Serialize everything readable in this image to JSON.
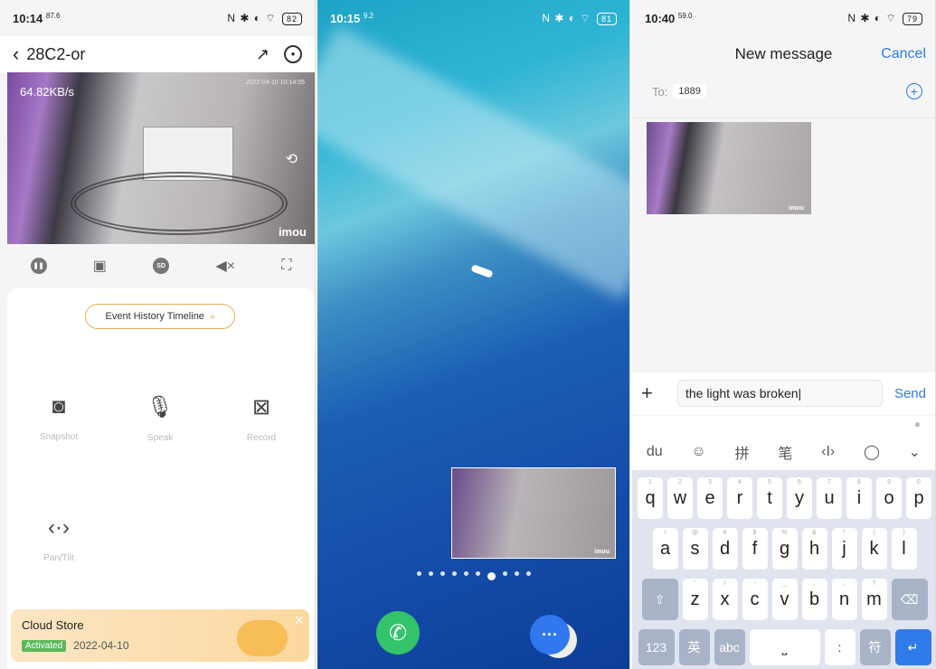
{
  "phone1": {
    "status": {
      "time": "10:14",
      "speed": "87.6",
      "battery": "82"
    },
    "header": {
      "title": "28C2-or"
    },
    "video": {
      "rate": "64.82KB/s",
      "timestamp": "2022-04-10 10:14:05",
      "brand": "imou"
    },
    "controls": {
      "sd": "SD"
    },
    "event_button": "Event History Timeline",
    "features": {
      "snapshot": "Snapshot",
      "speak": "Speak",
      "record": "Record",
      "pantilt": "Pan/Tilt"
    },
    "cloud": {
      "title": "Cloud Store",
      "status": "Activated",
      "date": "2022-04-10"
    }
  },
  "phone2": {
    "status": {
      "time": "10:15",
      "speed": "9.2",
      "battery": "81"
    },
    "pip": {
      "brand": "imou"
    },
    "page_dots": 10,
    "active_dot": 6
  },
  "phone3": {
    "status": {
      "time": "10:40",
      "speed": "59.0",
      "battery": "79"
    },
    "header": {
      "title": "New message",
      "cancel": "Cancel"
    },
    "to": {
      "label": "To:",
      "number": "1889"
    },
    "thumb": {
      "brand": "imou"
    },
    "compose": {
      "text": "the light was broken",
      "send": "Send"
    },
    "tools": [
      "du",
      "☺",
      "拼",
      "笔",
      "‹I›",
      "◯",
      "⌄"
    ],
    "keyboard": {
      "row1": [
        [
          "q",
          "1"
        ],
        [
          "w",
          "2"
        ],
        [
          "e",
          "3"
        ],
        [
          "r",
          "4"
        ],
        [
          "t",
          "5"
        ],
        [
          "y",
          "6"
        ],
        [
          "u",
          "7"
        ],
        [
          "i",
          "8"
        ],
        [
          "o",
          "9"
        ],
        [
          "p",
          "0"
        ]
      ],
      "row2": [
        [
          "a",
          "!"
        ],
        [
          "s",
          "@"
        ],
        [
          "d",
          "#"
        ],
        [
          "f",
          "$"
        ],
        [
          "g",
          "%"
        ],
        [
          "h",
          "&"
        ],
        [
          "j",
          "*"
        ],
        [
          "k",
          "("
        ],
        [
          "l",
          ")"
        ]
      ],
      "row3": [
        [
          "z",
          "'"
        ],
        [
          "x",
          "/"
        ],
        [
          "c",
          "-"
        ],
        [
          "v",
          "_"
        ],
        [
          "b",
          ":"
        ],
        [
          "n",
          ";"
        ],
        [
          "m",
          "?"
        ]
      ],
      "fn": {
        "num": "123",
        "lang": "英",
        "abc": "abc",
        "symbols": "符"
      }
    }
  }
}
